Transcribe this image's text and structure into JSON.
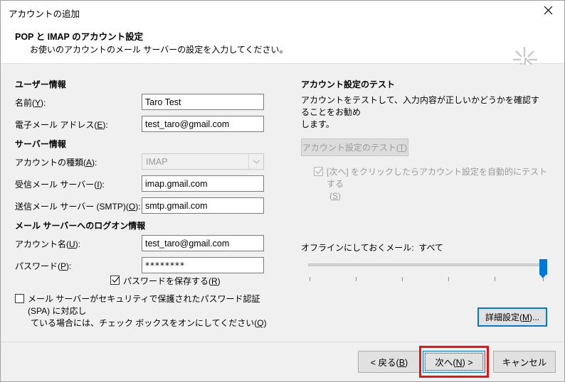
{
  "window": {
    "title": "アカウントの追加",
    "close_label": "✕"
  },
  "header": {
    "title": "POP と IMAP のアカウント設定",
    "subtitle": "お使いのアカウントのメール サーバーの設定を入力してください。",
    "watermark_icon": "cursor-sparkle-icon"
  },
  "left": {
    "group_user": "ユーザー情報",
    "name_label_pre": "名前(",
    "name_label_key": "Y",
    "name_label_post": "):",
    "name_value": "Taro Test",
    "email_label_pre": "電子メール アドレス(",
    "email_label_key": "E",
    "email_label_post": "):",
    "email_value": "test_taro@gmail.com",
    "group_server": "サーバー情報",
    "acct_type_label_pre": "アカウントの種類(",
    "acct_type_label_key": "A",
    "acct_type_label_post": "):",
    "acct_type_value": "IMAP",
    "incoming_label_pre": "受信メール サーバー(",
    "incoming_label_key": "I",
    "incoming_label_post": "):",
    "incoming_value": "imap.gmail.com",
    "outgoing_label_pre": "送信メール サーバー (SMTP)(",
    "outgoing_label_key": "O",
    "outgoing_label_post": "):",
    "outgoing_value": "smtp.gmail.com",
    "group_logon": "メール サーバーへのログオン情報",
    "account_label_pre": "アカウント名(",
    "account_label_key": "U",
    "account_label_post": "):",
    "account_value": "test_taro@gmail.com",
    "password_label_pre": "パスワード(",
    "password_label_key": "P",
    "password_label_post": "):",
    "password_value": "********",
    "save_password_pre": "パスワードを保存する(",
    "save_password_key": "R",
    "save_password_post": ")",
    "save_password_checked": true,
    "spa_line1": "メール サーバーがセキュリティで保護されたパスワード認証 (SPA) に対応し",
    "spa_line2_pre": "ている場合には、チェック ボックスをオンにしてください(",
    "spa_line2_key": "Q",
    "spa_line2_post": ")",
    "spa_checked": false
  },
  "right": {
    "test_title": "アカウント設定のテスト",
    "test_desc_line1": "アカウントをテストして、入力内容が正しいかどうかを確認することをお勧め",
    "test_desc_line2": "します。",
    "test_button_pre": "アカウント設定のテスト(",
    "test_button_key": "T",
    "test_button_post": ")",
    "test_button_disabled": true,
    "auto_test_line1": "[次へ] をクリックしたらアカウント設定を自動的にテストする",
    "auto_test_line2_pre": "(",
    "auto_test_line2_key": "S",
    "auto_test_line2_post": ")",
    "auto_test_checked": true,
    "offline_label": "オフラインにしておくメール:",
    "offline_value": "すべて",
    "slider_position_percent": 100,
    "slider_tick_count": 6,
    "more_button_pre": "詳細設定(",
    "more_button_key": "M",
    "more_button_post": ")..."
  },
  "footer": {
    "back_pre": "< 戻る(",
    "back_key": "B",
    "back_post": ")",
    "next_pre": "次へ(",
    "next_key": "N",
    "next_post": ") >",
    "cancel_label": "キャンセル"
  },
  "colors": {
    "accent_blue": "#0078d7",
    "annotation_red": "#ee1111",
    "dialog_bg": "#f0f0f0",
    "field_bg": "#ffffff"
  }
}
